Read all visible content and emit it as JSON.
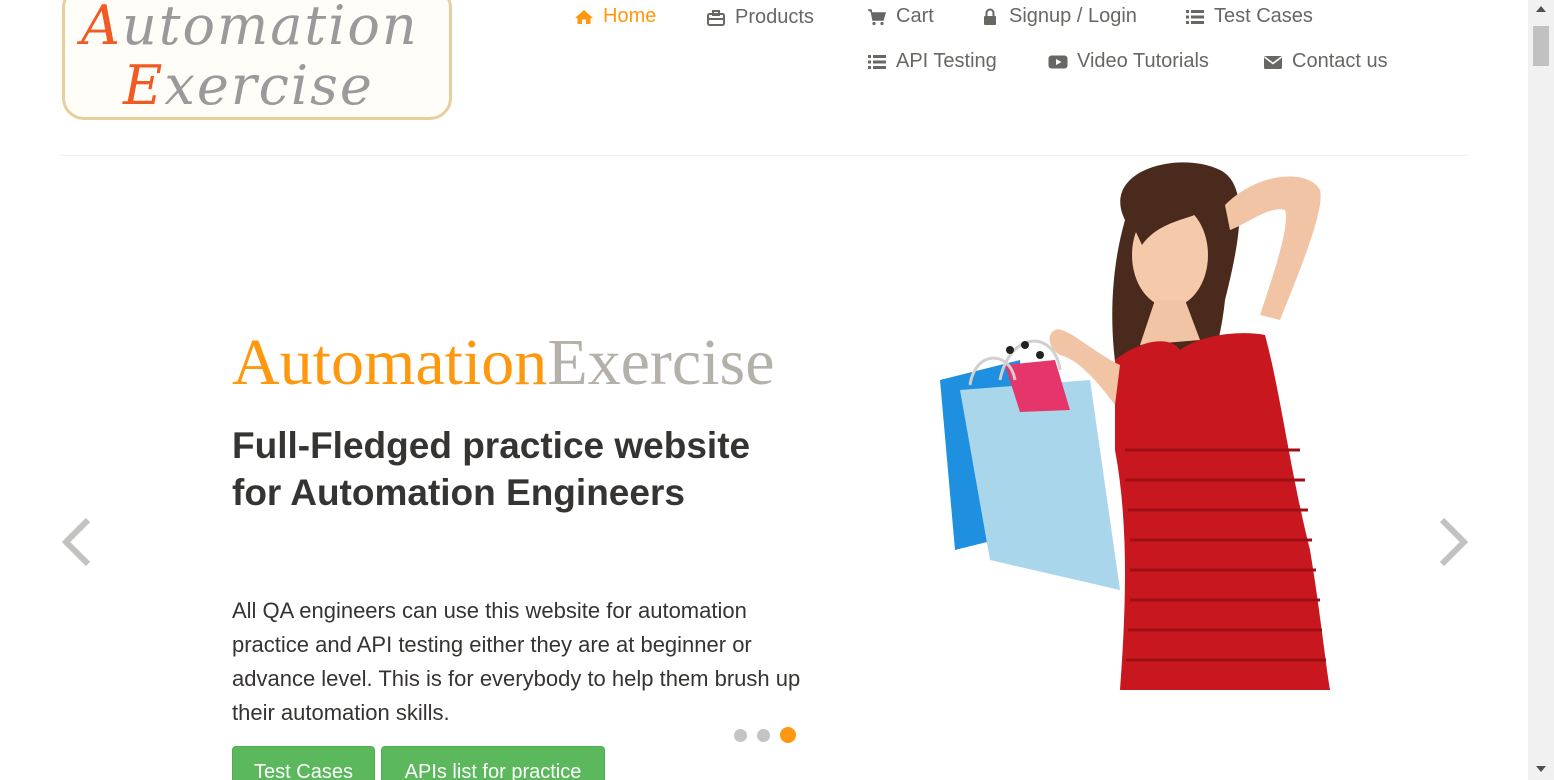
{
  "logo": {
    "line1_cap": "A",
    "line1_rest": "utomation",
    "line2_cap": "E",
    "line2_rest": "xercise"
  },
  "nav": {
    "items": [
      {
        "label": "Home",
        "icon": "home-icon",
        "active": true
      },
      {
        "label": "Products",
        "icon": "briefcase-icon"
      },
      {
        "label": "Cart",
        "icon": "cart-icon"
      },
      {
        "label": "Signup / Login",
        "icon": "lock-icon"
      },
      {
        "label": "Test Cases",
        "icon": "list-icon"
      },
      {
        "label": "API Testing",
        "icon": "list-icon"
      },
      {
        "label": "Video Tutorials",
        "icon": "youtube-play-icon"
      },
      {
        "label": "Contact us",
        "icon": "envelope-icon"
      }
    ]
  },
  "hero": {
    "brand_part1": "Automation",
    "brand_part2": "Exercise",
    "heading": "Full-Fledged practice website for Automation Engineers",
    "description": "All QA engineers can use this website for automation practice and API testing either they are at beginner or advance level. This is for everybody to help them brush up their automation skills.",
    "buttons": {
      "test_cases": "Test Cases",
      "apis": "APIs list for practice"
    },
    "carousel": {
      "slides": 3,
      "active_slide": 3
    }
  },
  "colors": {
    "accent": "#FE980F",
    "button_green": "#5CB85C",
    "text_dark": "#363432",
    "nav_text": "#696763"
  }
}
